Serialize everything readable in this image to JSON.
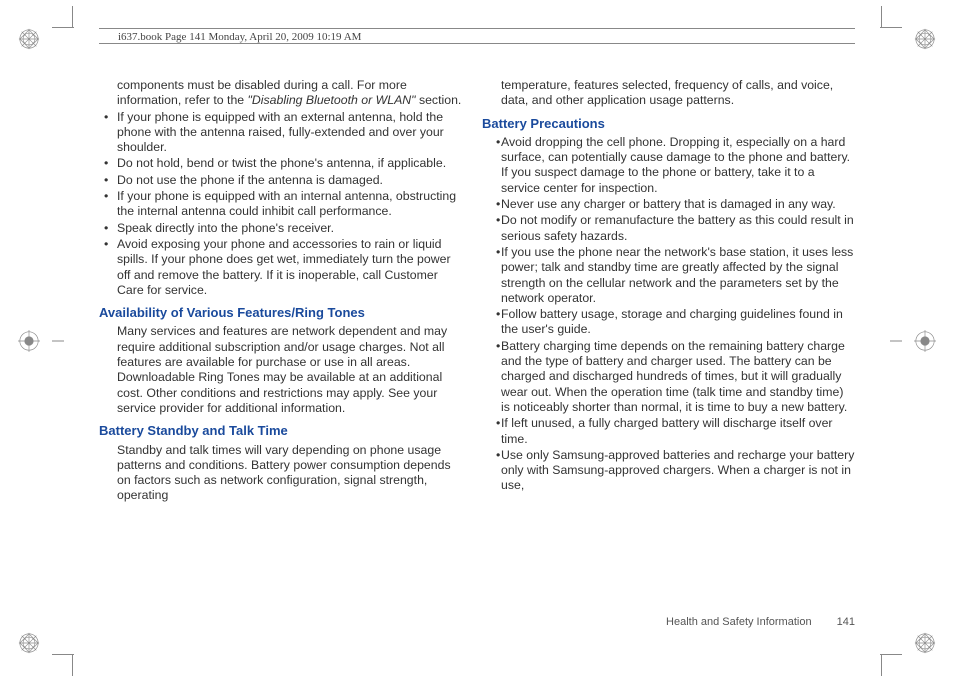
{
  "header": {
    "running": "i637.book  Page 141  Monday, April 20, 2009  10:19 AM"
  },
  "left": {
    "para0a": "components must be disabled during a call. For more information, refer to the ",
    "para0b": "\"Disabling Bluetooth or WLAN\"",
    "para0c": " section.",
    "b1": "If your phone is equipped with an external antenna, hold the phone with the antenna raised, fully-extended and over your shoulder.",
    "b2": "Do not hold, bend or twist the phone's antenna, if applicable.",
    "b3": "Do not use the phone if the antenna is damaged.",
    "b4": "If your phone is equipped with an internal antenna, obstructing the internal antenna could inhibit call performance.",
    "b5": "Speak directly into the phone's receiver.",
    "b6": "Avoid exposing your phone and accessories to rain or liquid spills. If your phone does get wet, immediately turn the power off and remove the battery. If it is inoperable, call Customer Care for service.",
    "h1": "Availability of Various Features/Ring Tones",
    "p1": "Many services and features are network dependent and may require additional subscription and/or usage charges. Not all features are available for purchase or use in all areas. Downloadable Ring Tones may be available at an additional cost. Other conditions and restrictions may apply. See your service provider for additional information.",
    "h2": "Battery Standby and Talk Time",
    "p2": "Standby and talk times will vary depending on phone usage patterns and conditions. Battery power consumption depends on factors such as network configuration, signal strength, operating"
  },
  "right": {
    "p0": "temperature, features selected, frequency of calls, and voice, data, and other application usage patterns.",
    "h1": "Battery Precautions",
    "b1": "Avoid dropping the cell phone. Dropping it, especially on a hard surface, can potentially cause damage to the phone and battery. If you suspect damage to the phone or battery, take it to a service center for inspection.",
    "b2": "Never use any charger or battery that is damaged in any way.",
    "b3": "Do not modify or remanufacture the battery as this could result in serious safety hazards.",
    "b4": "If you use the phone near the network's base station, it uses less power; talk and standby time are greatly affected by the signal strength on the cellular network and the parameters set by the network operator.",
    "b5": "Follow battery usage, storage and charging guidelines found in the user's guide.",
    "b6": "Battery charging time depends on the remaining battery charge and the type of battery and charger used. The battery can be charged and discharged hundreds of times, but it will gradually wear out. When the operation time (talk time and standby time) is noticeably shorter than normal, it is time to buy a new battery.",
    "b7": "If left unused, a fully charged battery will discharge itself over time.",
    "b8": "Use only Samsung-approved batteries and recharge your battery only with Samsung-approved chargers. When a charger is not in use,"
  },
  "footer": {
    "section": "Health and Safety Information",
    "page": "141"
  }
}
